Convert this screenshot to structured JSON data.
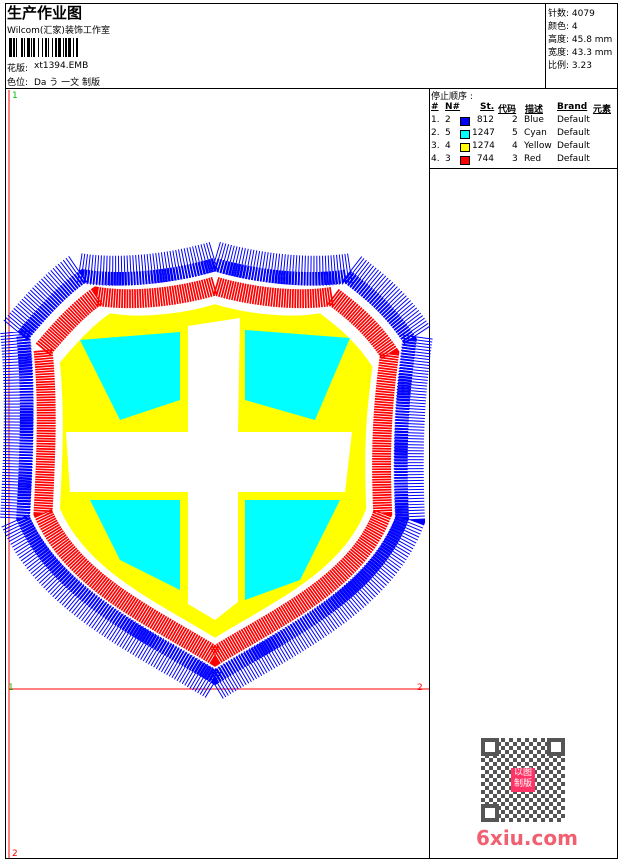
{
  "header": {
    "title": "生产作业图",
    "company": "Wilcom(汇家)装饰工作室",
    "design_label": "花版:",
    "design_value": "xt1394.EMB",
    "color_label": "色位:",
    "color_value": "Da う 一文 制版"
  },
  "info": {
    "stitches": "针数: 4079",
    "colors": "颜色: 4",
    "height": "高度: 45.8 mm",
    "width": "宽度: 43.3 mm",
    "scale": "比例: 3.23"
  },
  "stop_sequence": {
    "title": "停止顺序 :",
    "headers": [
      "#",
      "N#",
      "St.",
      "代码",
      "描述",
      "Brand",
      "元素"
    ],
    "rows": [
      {
        "idx": "1.",
        "n": "2",
        "color": "#0000ff",
        "st": "812",
        "code": "2",
        "desc": "Blue",
        "brand": "Default"
      },
      {
        "idx": "2.",
        "n": "5",
        "color": "#00ffff",
        "st": "1247",
        "code": "5",
        "desc": "Cyan",
        "brand": "Default"
      },
      {
        "idx": "3.",
        "n": "4",
        "color": "#ffff00",
        "st": "1274",
        "code": "4",
        "desc": "Yellow",
        "brand": "Default"
      },
      {
        "idx": "4.",
        "n": "3",
        "color": "#ff0000",
        "st": "744",
        "code": "3",
        "desc": "Red",
        "brand": "Default"
      }
    ]
  },
  "canvas": {
    "marker_top_left": "1",
    "marker_mid_left": "1",
    "marker_mid_right": "2",
    "marker_bottom_left": "2"
  },
  "watermark": {
    "text": "6xiu.com",
    "stamp": "以图制版"
  }
}
